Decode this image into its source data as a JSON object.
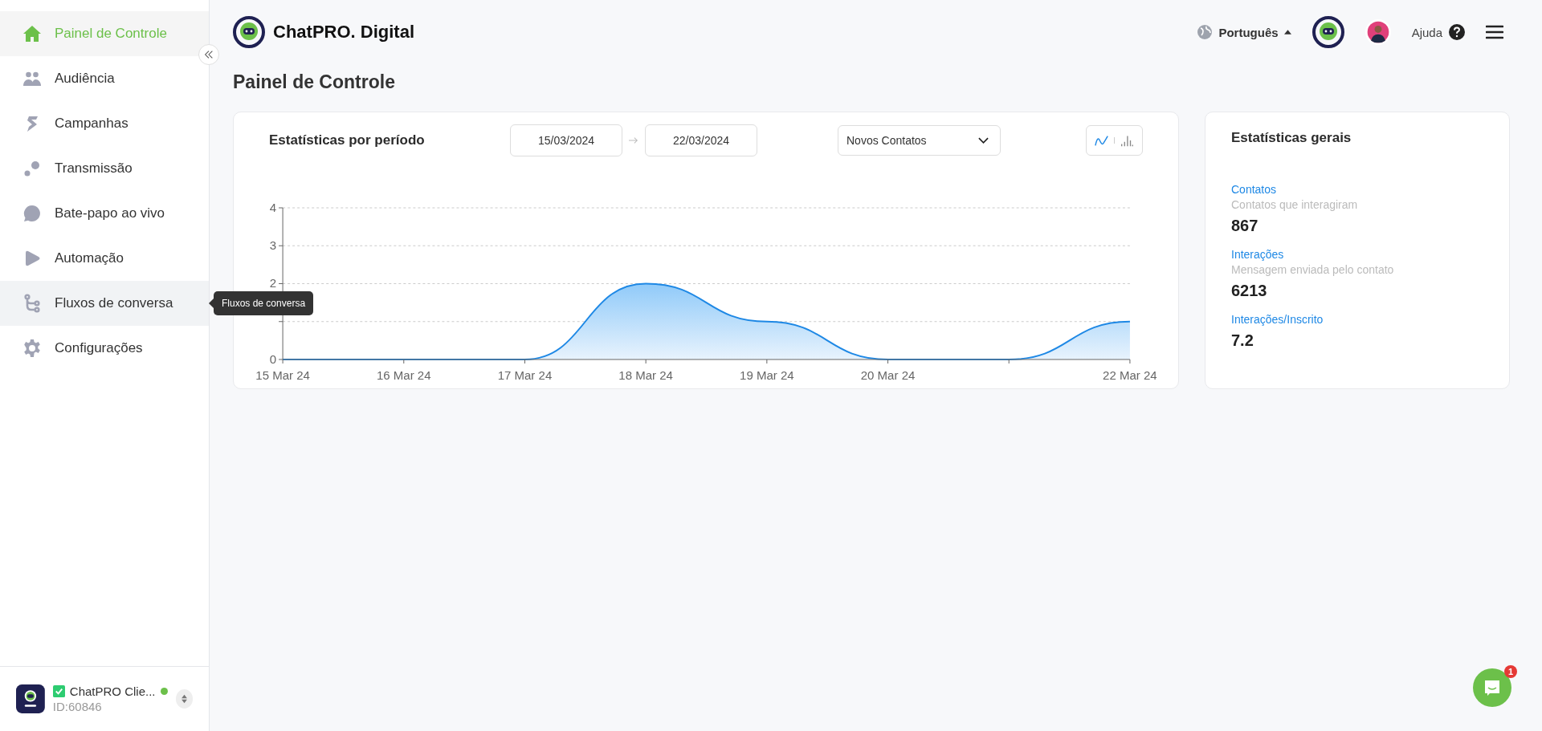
{
  "sidebar": {
    "items": [
      {
        "kind": "home",
        "label": "Painel de Controle",
        "selected": true,
        "hovered": false
      },
      {
        "kind": "people",
        "label": "Audiência",
        "selected": false,
        "hovered": false
      },
      {
        "kind": "campaign",
        "label": "Campanhas",
        "selected": false,
        "hovered": false
      },
      {
        "kind": "broadcast",
        "label": "Transmissão",
        "selected": false,
        "hovered": false
      },
      {
        "kind": "chat",
        "label": "Bate-papo ao vivo",
        "selected": false,
        "hovered": false
      },
      {
        "kind": "play",
        "label": "Automação",
        "selected": false,
        "hovered": false
      },
      {
        "kind": "flow",
        "label": "Fluxos de conversa",
        "selected": false,
        "hovered": true
      },
      {
        "kind": "gear",
        "label": "Configurações",
        "selected": false,
        "hovered": false
      }
    ],
    "tooltip": "Fluxos de conversa",
    "account": {
      "verified": true,
      "name": "ChatPRO Clie...",
      "online": true,
      "id": "ID:60846"
    }
  },
  "header": {
    "brand": "ChatPRO. Digital",
    "language": "Português",
    "help": "Ajuda"
  },
  "page_title": "Painel de Controle",
  "period_card": {
    "title": "Estatísticas por período",
    "date_from": "15/03/2024",
    "date_to": "22/03/2024",
    "metric": "Novos Contatos",
    "view_buttons": [
      {
        "kind": "line",
        "selected": true
      },
      {
        "kind": "bar",
        "selected": false
      }
    ],
    "chart_data": {
      "type": "area",
      "categories": [
        "15 Mar 24",
        "16 Mar 24",
        "17 Mar 24",
        "18 Mar 24",
        "19 Mar 24",
        "20 Mar 24",
        null,
        "22 Mar 24"
      ],
      "series": [
        {
          "color": "#1e88e5",
          "values": [
            0,
            0,
            0,
            2,
            1,
            0,
            0,
            1
          ]
        }
      ],
      "ylim": [
        0,
        4
      ],
      "yticks": [
        0,
        2,
        3,
        4
      ]
    }
  },
  "general_card": {
    "title": "Estatísticas gerais",
    "stats": [
      {
        "label": "Contatos",
        "description": "Contatos que interagiram",
        "value": "867"
      },
      {
        "label": "Interações",
        "description": "Mensagem enviada pelo contato",
        "value": "6213"
      },
      {
        "label": "Interações/Inscrito",
        "value": "7.2"
      }
    ]
  },
  "chat_widget": {
    "badge": "1"
  }
}
